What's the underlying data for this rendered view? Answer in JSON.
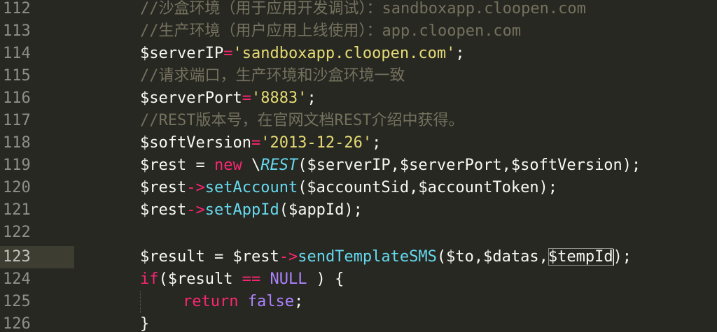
{
  "editor": {
    "line_numbers": [
      "112",
      "113",
      "114",
      "115",
      "116",
      "117",
      "118",
      "119",
      "120",
      "121",
      "122",
      "123",
      "124",
      "125",
      "126"
    ],
    "current_line": "123",
    "colors": {
      "background": "#272822",
      "current_line": "#3e3d32",
      "comment": "#75715e",
      "keyword": "#f92672",
      "string": "#e6db74",
      "function": "#66d9ef",
      "constant": "#ae81ff",
      "text": "#f8f8f2"
    }
  },
  "code": {
    "l112": {
      "comment": "//沙盒环境（用于应用开发调试）：sandboxapp.cloopen.com"
    },
    "l113": {
      "comment": "//生产环境（用户应用上线使用）：app.cloopen.com"
    },
    "l114": {
      "var": "$serverIP",
      "op": "=",
      "str": "'sandboxapp.cloopen.com'",
      "end": ";"
    },
    "l115": {
      "comment": "//请求端口，生产环境和沙盒环境一致"
    },
    "l116": {
      "var": "$serverPort",
      "op": "=",
      "str": "'8883'",
      "end": ";"
    },
    "l117": {
      "comment": "//REST版本号，在官网文档REST介绍中获得。"
    },
    "l118": {
      "var": "$softVersion",
      "op": "=",
      "str": "'2013-12-26'",
      "end": ";"
    },
    "l119": {
      "var": "$rest",
      "op": " = ",
      "kw": "new",
      "ns": " \\",
      "cls": "REST",
      "args": "($serverIP,$serverPort,$softVersion);"
    },
    "l120": {
      "var": "$rest",
      "arrow": "->",
      "fn": "setAccount",
      "args": "($accountSid,$accountToken);"
    },
    "l121": {
      "var": "$rest",
      "arrow": "->",
      "fn": "setAppId",
      "args": "($appId);"
    },
    "l123": {
      "var": "$result",
      "op": " = ",
      "var2": "$rest",
      "arrow": "->",
      "fn": "sendTemplateSMS",
      "args_a": "($to,$datas,",
      "args_hl": "$tempId",
      "args_b": ");"
    },
    "l124": {
      "kw": "if",
      "open": "(",
      "var": "$result",
      "op": " == ",
      "const": "NULL",
      "close": " ) {"
    },
    "l125": {
      "kw": "return",
      "const": " false",
      "end": ";"
    },
    "l126": {
      "brace": "}"
    }
  }
}
